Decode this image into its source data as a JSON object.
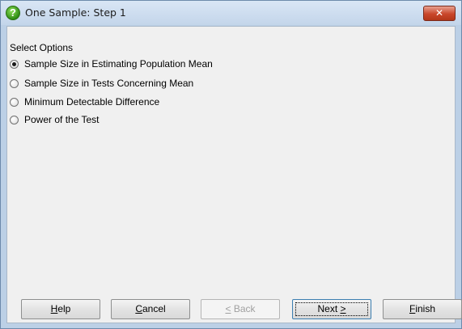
{
  "window": {
    "title": "One Sample: Step 1",
    "app_icon_glyph": "?",
    "close_glyph": "✕"
  },
  "options": {
    "group_label": "Select Options",
    "items": [
      {
        "label": "Sample Size in Estimating Population Mean",
        "checked": true
      },
      {
        "label": "Sample Size in Tests Concerning Mean",
        "checked": false
      },
      {
        "label": "Minimum Detectable Difference",
        "checked": false
      },
      {
        "label": "Power of the Test",
        "checked": false
      }
    ]
  },
  "buttons": {
    "help": {
      "mnemonic": "H",
      "rest": "elp",
      "enabled": true
    },
    "cancel": {
      "mnemonic": "C",
      "rest": "ancel",
      "enabled": true
    },
    "back": {
      "mnemonic": "<",
      "rest": " Back",
      "enabled": false
    },
    "next": {
      "prefix": "Next ",
      "mnemonic": ">",
      "enabled": true,
      "default": true
    },
    "finish": {
      "mnemonic": "F",
      "rest": "inish",
      "enabled": true
    }
  }
}
